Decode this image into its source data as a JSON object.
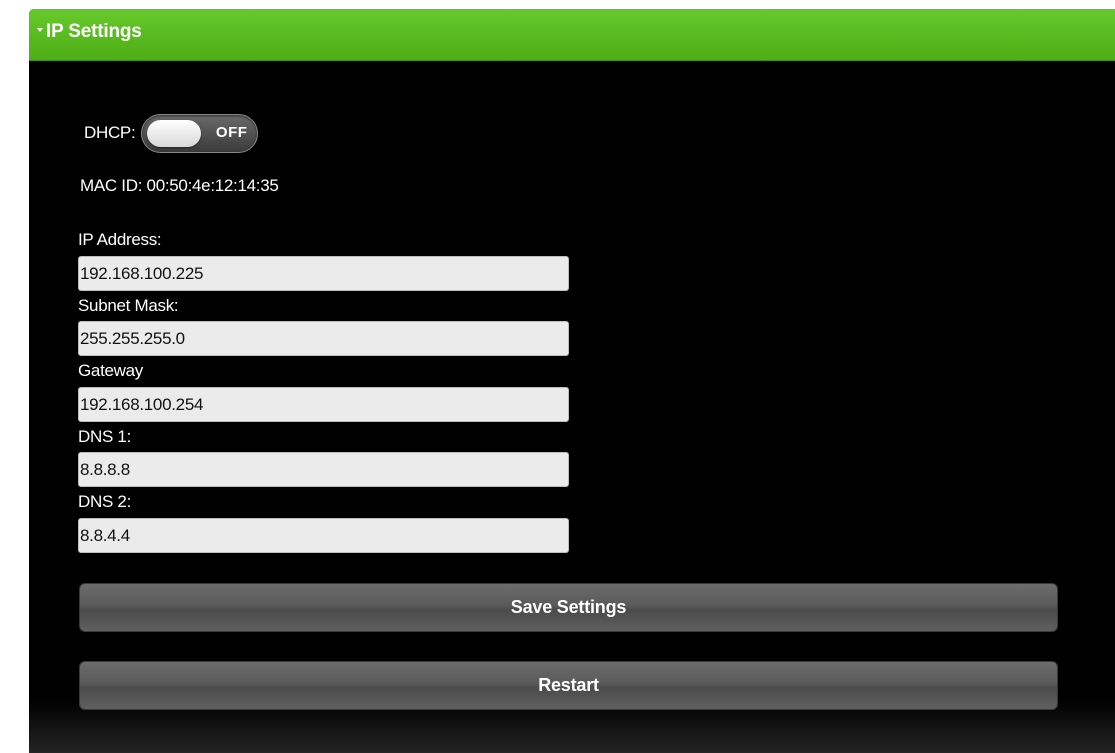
{
  "panel": {
    "title": "IP Settings",
    "collapse_icon": "caret-down-icon"
  },
  "dhcp": {
    "label": "DHCP:",
    "state_label": "OFF",
    "enabled": false
  },
  "mac": {
    "text": "MAC ID: 00:50:4e:12:14:35"
  },
  "fields": {
    "ip_address": {
      "label": "IP Address:",
      "value": "192.168.100.225"
    },
    "subnet_mask": {
      "label": "Subnet Mask:",
      "value": "255.255.255.0"
    },
    "gateway": {
      "label": "Gateway",
      "value": "192.168.100.254"
    },
    "dns1": {
      "label": "DNS 1:",
      "value": "8.8.8.8"
    },
    "dns2": {
      "label": "DNS 2:",
      "value": "8.8.4.4"
    }
  },
  "buttons": {
    "save": "Save Settings",
    "restart": "Restart"
  },
  "colors": {
    "header_green": "#5cbd20",
    "panel_background": "#000000",
    "input_background": "#ebebeb",
    "button_gray": "#5a5a5a"
  }
}
